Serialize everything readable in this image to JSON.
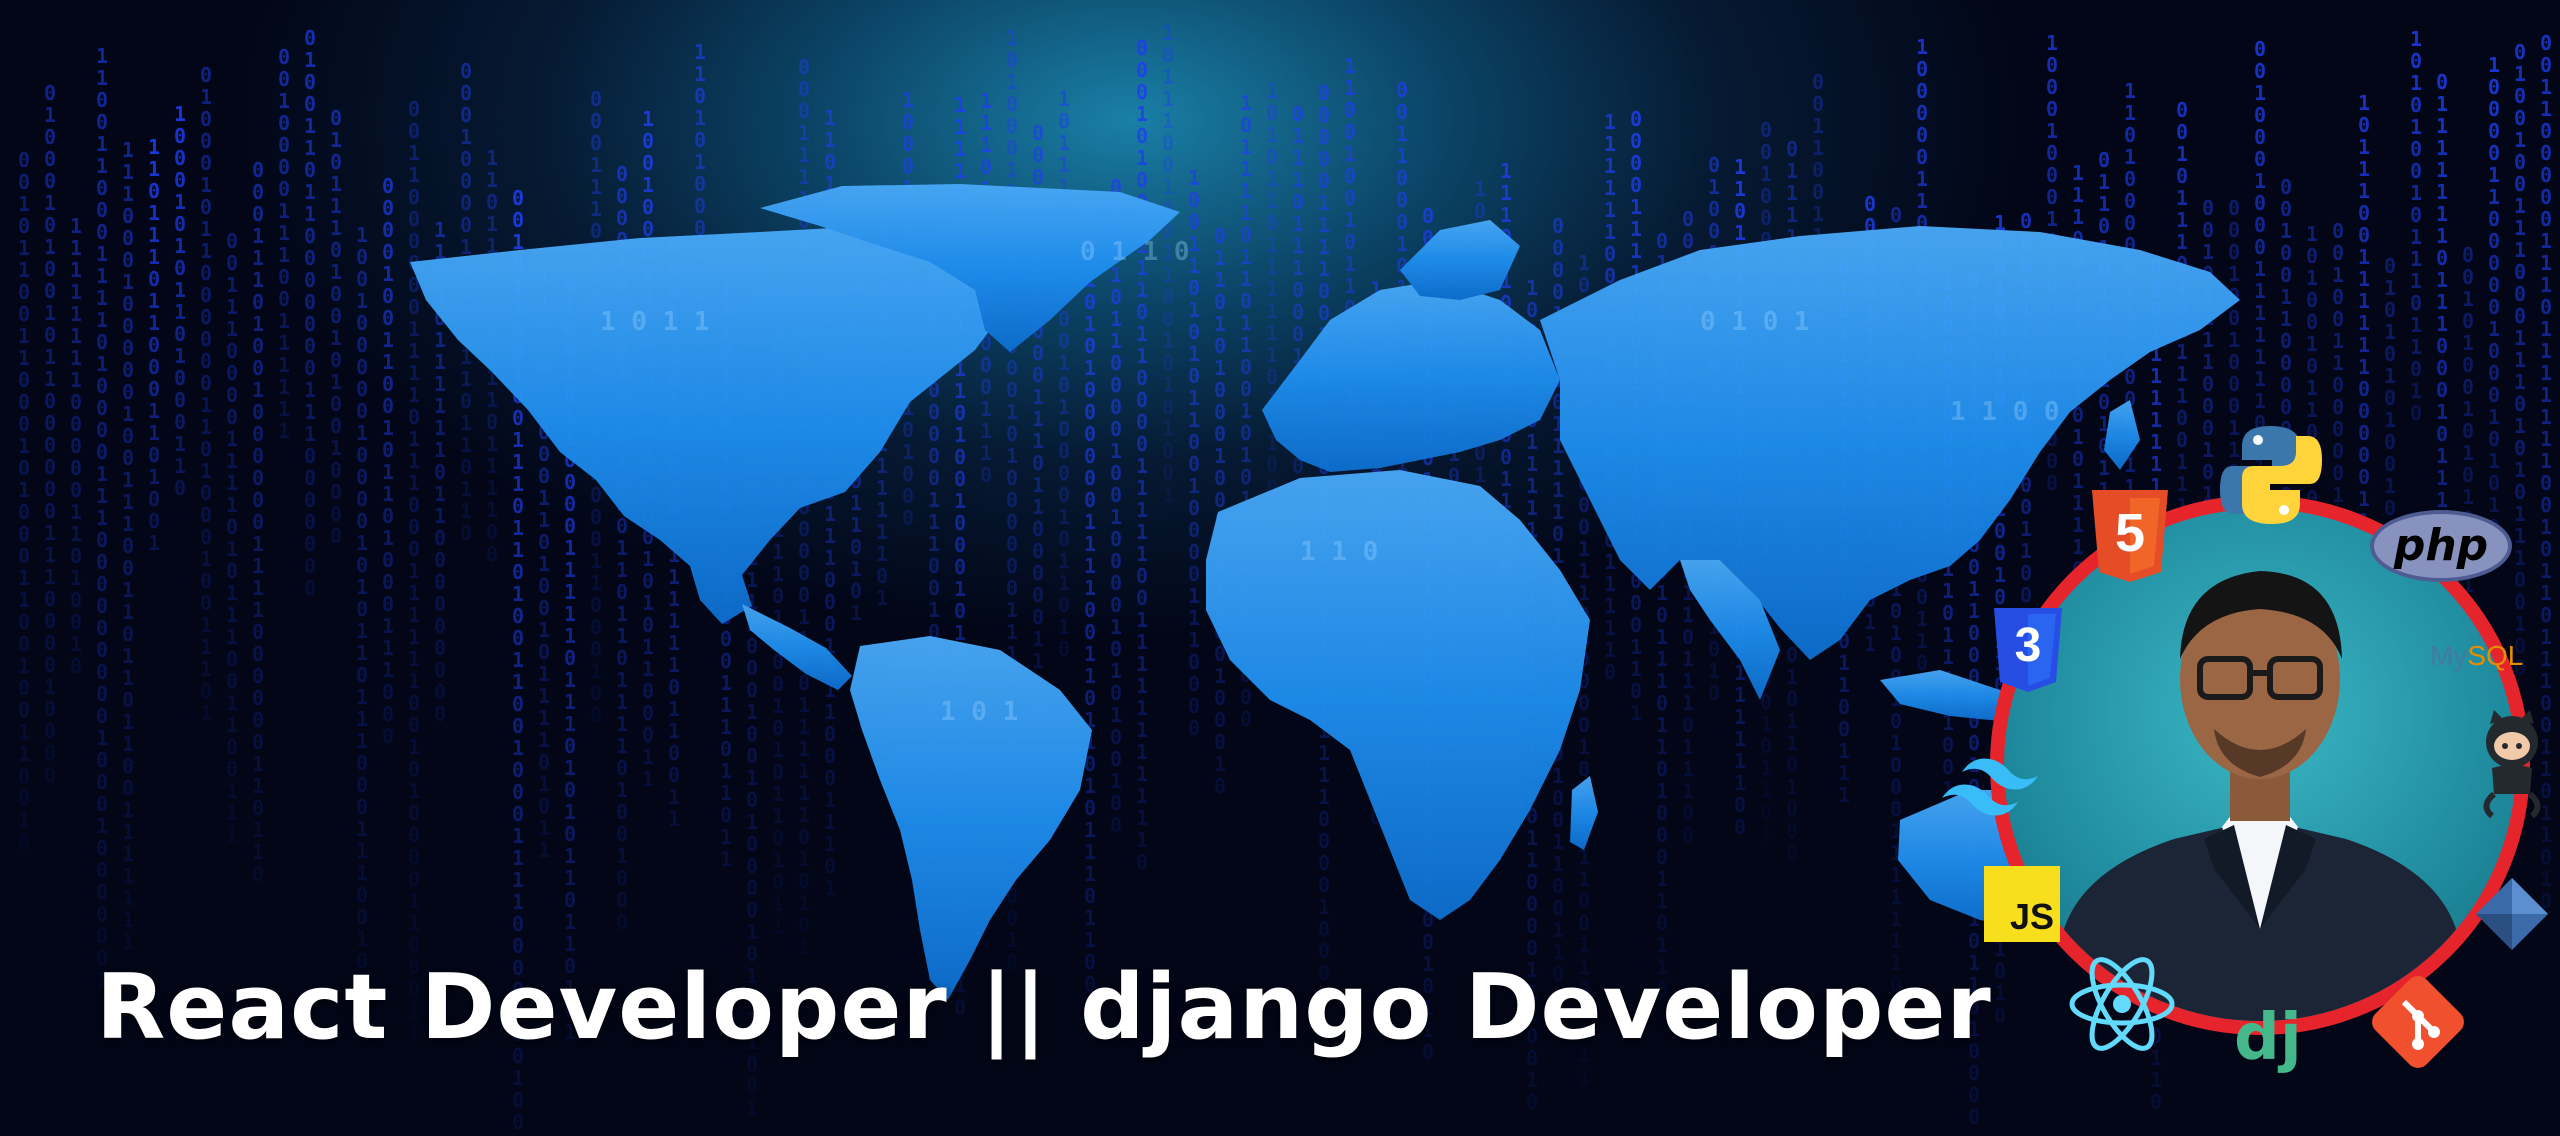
{
  "headline": "React Developer || django Developer",
  "icons": {
    "html5": "5",
    "css3": "3",
    "javascript": "JS",
    "php": "php",
    "mysql_a": "My",
    "mysql_b": "SQL",
    "django": "dj"
  },
  "colors": {
    "background": "#020617",
    "map": "#1f8ff0",
    "binary": "#1e3ef0",
    "ring": "#e5252b",
    "portrait_bg": "#1f8b9e",
    "headline": "#ffffff"
  }
}
